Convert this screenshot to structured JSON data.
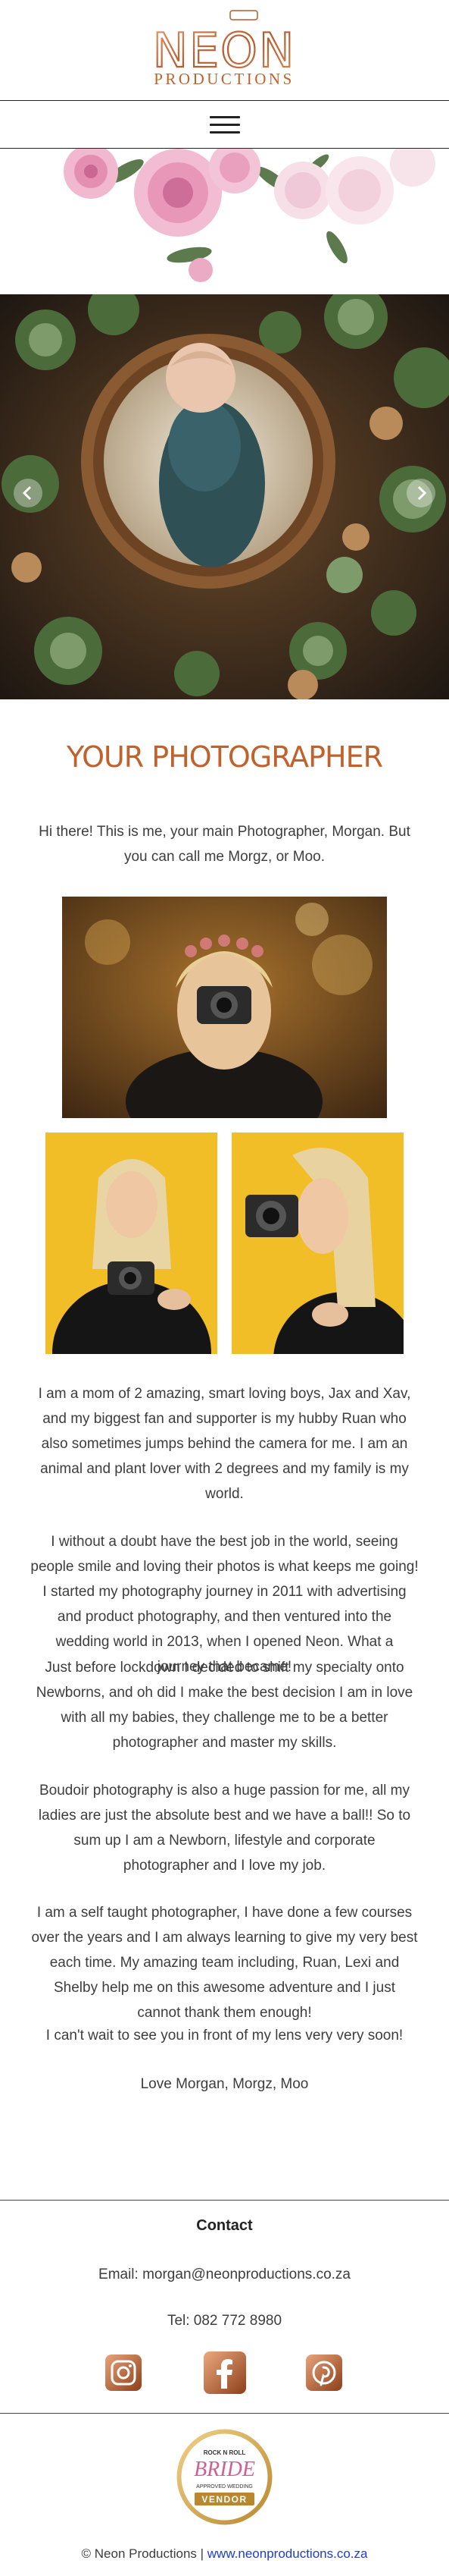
{
  "brand": {
    "logo_word": "NEON",
    "logo_sub": "PRODUCTIONS",
    "accent": "#c0622e"
  },
  "nav": {
    "menu_icon": "hamburger-icon"
  },
  "slider": {
    "prev_icon": "chevron-left-icon",
    "next_icon": "chevron-right-icon"
  },
  "about": {
    "title": "YOUR PHOTOGRAPHER",
    "intro": "Hi there! This is me, your main Photographer, Morgan. But you can call me Morgz, or Moo.",
    "paragraphs": [
      "I am a mom of 2 amazing, smart loving boys, Jax and Xav, and my biggest fan and supporter is my hubby Ruan who also sometimes jumps behind the camera for me. I am an animal and plant lover with 2 degrees and my family is my world.",
      "I without a doubt have the best job in the world, seeing people smile and loving their photos is what keeps me going! I started my photography journey in 2011 with advertising and product photography, and then ventured into the wedding world in 2013, when I opened Neon. What a journey that became!",
      "Just before lockdown I decided to shift my specialty onto Newborns, and oh did I make the best decision I am in love with all my babies, they challenge me to be a better photographer and master my skills.",
      "Boudoir photography is also a huge passion for me, all my ladies are just the absolute best and we have a ball!! So to sum up I am a Newborn, lifestyle and corporate photographer and I love my job.",
      "I am a self taught photographer, I have done a few courses over the years and I am always learning to give my very best each time. My amazing team including, Ruan, Lexi and Shelby help me on this awesome adventure and I just cannot thank them enough!",
      "I can't wait to see you in front of my lens very very soon!",
      "Love Morgan, Morgz, Moo"
    ]
  },
  "contact": {
    "title": "Contact",
    "email": "Email: morgan@neonproductions.co.za",
    "tel": "Tel: 082 772 8980",
    "social": [
      "instagram-icon",
      "facebook-icon",
      "pinterest-icon"
    ]
  },
  "badge": {
    "line1": "ROCK N ROLL",
    "word": "BRIDE",
    "line2": "APPROVED WEDDING",
    "line3": "VENDOR"
  },
  "footer": {
    "copyright": "© Neon Productions |",
    "link": "www.neonproductions.co.za"
  }
}
